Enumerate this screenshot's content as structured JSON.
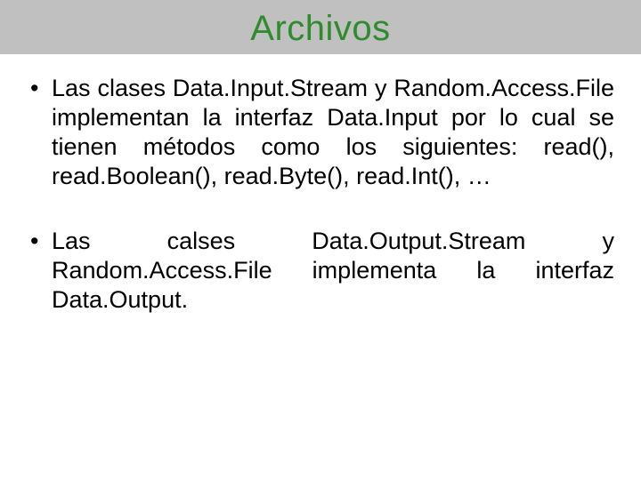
{
  "title": "Archivos",
  "bullets": [
    "Las clases Data.Input.Stream y Random.Access.File implementan la interfaz Data.Input por lo cual se tienen métodos como los siguientes: read(), read.Boolean(), read.Byte(), read.Int(), …",
    "Las calses Data.Output.Stream y Random.Access.File implementa la interfaz Data.Output."
  ]
}
